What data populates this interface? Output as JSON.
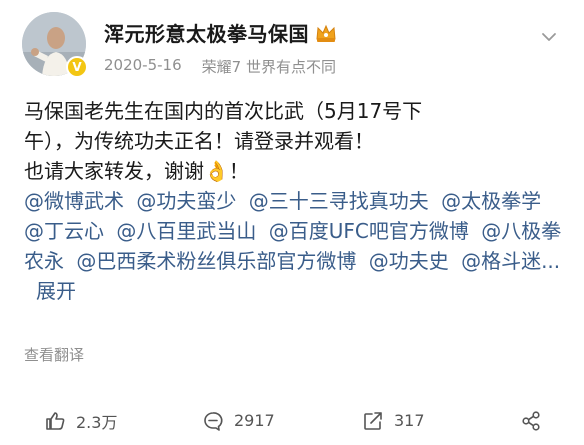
{
  "post": {
    "author": "浑元形意太极拳马保国",
    "date": "2020-5-16",
    "device": "荣耀7 世界有点不同",
    "line1": "马保国老先生在国内的首次比武（5月17号下",
    "line2": "午），为传统功夫正名！请登录并观看！",
    "line3_a": "也请大家转发，谢谢",
    "line3_emoji": "👌",
    "line3_b": "！",
    "mentions": [
      "@微博武术",
      "@功夫蛮少",
      "@三十三寻找真功夫",
      "@太极拳学",
      "@丁云心",
      "@八百里武当山",
      "@百度UFC吧官方微博",
      "@八极拳农永",
      "@巴西柔术粉丝俱乐部官方微博",
      "@功夫史",
      "@格斗迷..."
    ],
    "expand": "展开",
    "translate": "查看翻译"
  },
  "actions": {
    "likes": "2.3万",
    "comments": "2917",
    "reposts": "317"
  },
  "colors": {
    "link": "#3a5d8a",
    "meta": "#8f8f8f",
    "verified": "#f3c613"
  }
}
